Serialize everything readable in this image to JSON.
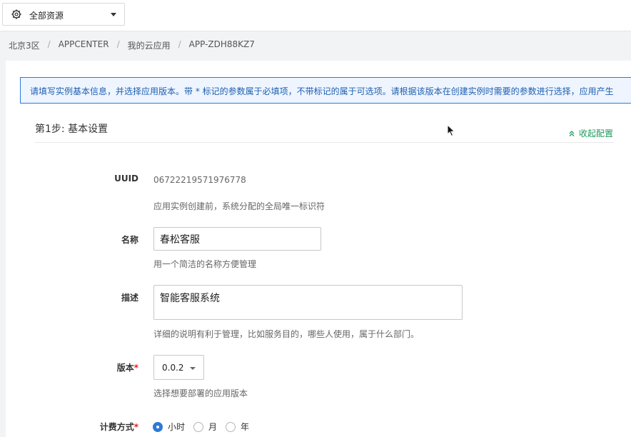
{
  "topbar": {
    "resource_select": {
      "label": "全部资源",
      "icon": "gear-icon"
    }
  },
  "breadcrumb": {
    "items": [
      "北京3区",
      "APPCENTER",
      "我的云应用",
      "APP-ZDH88KZ7"
    ],
    "separator": "/"
  },
  "notice": {
    "text": "请填写实例基本信息，并选择应用版本。带 * 标记的参数属于必填项，不带标记的属于可选项。请根据该版本在创建实例时需要的参数进行选择，应用产生"
  },
  "step": {
    "title": "第1步: 基本设置",
    "collapse_label": "收起配置"
  },
  "form": {
    "uuid": {
      "label": "UUID",
      "value": "06722219571976778",
      "hint": "应用实例创建前，系统分配的全局唯一标识符"
    },
    "name": {
      "label": "名称",
      "value": "春松客服",
      "hint": "用一个简洁的名称方便管理"
    },
    "description": {
      "label": "描述",
      "value": "智能客服系统",
      "hint": "详细的说明有利于管理，比如服务目的，哪些人使用，属于什么部门。"
    },
    "version": {
      "label": "版本",
      "required_mark": "*",
      "value": "0.0.2",
      "hint": "选择想要部署的应用版本"
    },
    "billing": {
      "label": "计费方式",
      "required_mark": "*",
      "options": [
        {
          "label": "小时",
          "checked": true
        },
        {
          "label": "月",
          "checked": false
        },
        {
          "label": "年",
          "checked": false
        }
      ]
    }
  },
  "colors": {
    "accent_blue": "#2d7ad6",
    "collapse_green": "#1e9a5c",
    "required_red": "#e02020",
    "notice_bg": "#eef5ff"
  }
}
